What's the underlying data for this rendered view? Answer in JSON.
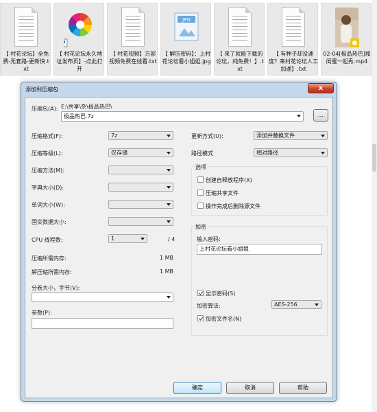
{
  "files": [
    {
      "label": "【 村花论坛】全免费-无套路-更新快.txt",
      "icon": "text-file-icon"
    },
    {
      "label": "【 村花论坛永久地址发布页】-点此打开",
      "icon": "shortcut-pinwheel-icon"
    },
    {
      "label": "【 村花视频】万部视频免费在线看.txt",
      "icon": "text-file-icon"
    },
    {
      "label": "【 解压密码】：上村花论坛看小姐姐.jpg",
      "icon": "jpg-image-icon"
    },
    {
      "label": "【 来了就能下载的论坛，纯免费！】.txt",
      "icon": "text-file-icon"
    },
    {
      "label": "【 有种子却没速度？来村花论坛人工加速】.txt",
      "icon": "text-file-icon"
    },
    {
      "label": "02-04[极品热巴]和闺蜜一起秀.mp4",
      "icon": "video-thumbnail-icon"
    }
  ],
  "dialog": {
    "title": "添加到压缩包",
    "close_glyph": "x",
    "archive_label": "压缩包(A):",
    "archive_path": "E:\\共享\\杂\\极品热巴\\",
    "archive_name": "极品热巴.7z",
    "browse_label": "...",
    "format_label": "压缩格式(F):",
    "format_value": "7z",
    "level_label": "压缩等级(L):",
    "level_value": "仅存储",
    "method_label": "压缩方法(M):",
    "method_value": "",
    "dict_label": "字典大小(D):",
    "dict_value": "",
    "word_label": "单词大小(W):",
    "word_value": "",
    "solid_label": "固实数据大小:",
    "solid_value": "",
    "threads_label": "CPU 线程数:",
    "threads_value": "1",
    "threads_total": "/ 4",
    "mem_comp_label": "压缩所需内存:",
    "mem_comp_value": "1 MB",
    "mem_decomp_label": "解压缩所需内存:",
    "mem_decomp_value": "1 MB",
    "split_label": "分卷大小，字节(V):",
    "split_value": "",
    "params_label": "参数(P):",
    "params_value": "",
    "update_label": "更新方式(U):",
    "update_value": "添加并替换文件",
    "pathmode_label": "路径模式",
    "pathmode_value": "相对路径",
    "options_title": "选项",
    "opt_sfx": "创建自释放程序(X)",
    "opt_shared": "压缩共享文件",
    "opt_delete": "操作完成后删除源文件",
    "encrypt_title": "加密",
    "password_label": "输入密码:",
    "password_value": "上村花论坛看小姐姐",
    "show_password": "显示密码(S)",
    "enc_method_label": "加密算法:",
    "enc_method_value": "AES-256",
    "encrypt_names": "加密文件名(N)",
    "ok_label": "确定",
    "cancel_label": "取消",
    "help_label": "帮助"
  },
  "checkboxes": {
    "sfx": false,
    "shared": false,
    "delete": false,
    "show_password": true,
    "encrypt_names": true
  }
}
